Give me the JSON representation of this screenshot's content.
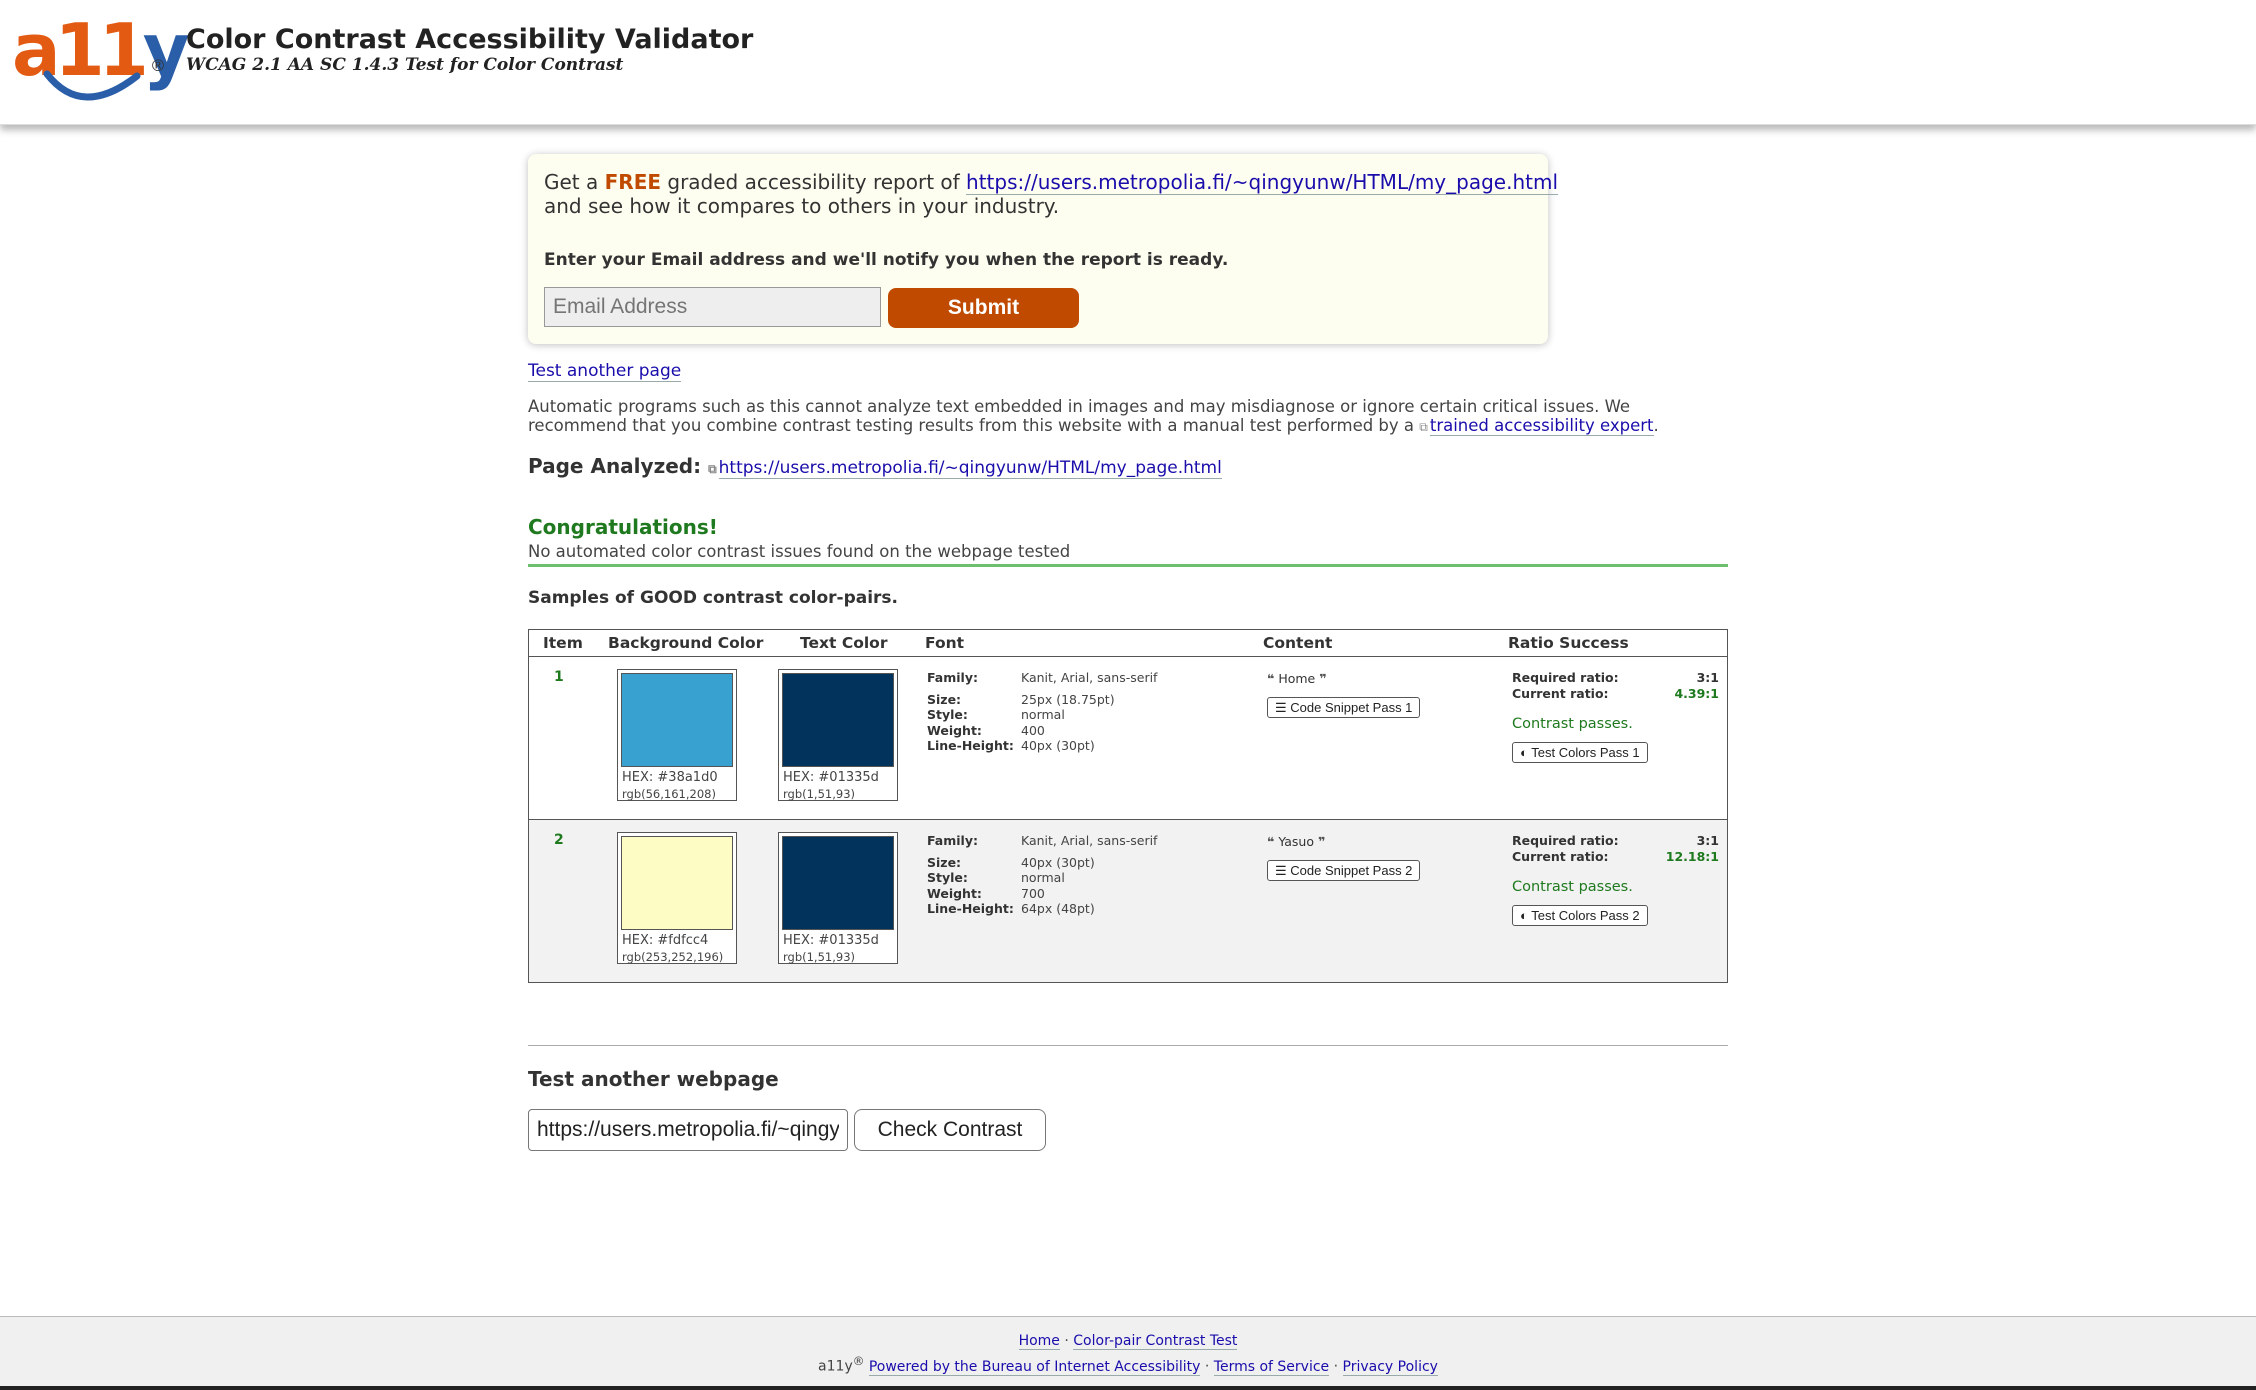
{
  "header": {
    "logo": {
      "text_a": "a",
      "text_11": "11",
      "text_y": "y",
      "reg": "®"
    },
    "title": "Color Contrast Accessibility Validator",
    "subtitle": "WCAG 2.1 AA SC 1.4.3 Test for Color Contrast"
  },
  "promo": {
    "line1_prefix": "Get a ",
    "free": "FREE",
    "line1_middle": " graded accessibility report of ",
    "url": "https://users.metropolia.fi/~qingyunw/HTML/my_page.html",
    "line2": "and see how it compares to others in your industry.",
    "notify": "Enter your Email address and we'll notify you when the report is ready.",
    "email_placeholder": "Email Address",
    "submit_label": "Submit"
  },
  "test_another_link": "Test another page",
  "disclaimer": {
    "text": "Automatic programs such as this cannot analyze text embedded in images and may misdiagnose or ignore certain critical issues. We recommend that you combine contrast testing results from this website with a manual test performed by a ",
    "link": "trained accessibility expert",
    "end": "."
  },
  "page_analyzed": {
    "label": "Page Analyzed:",
    "url": "https://users.metropolia.fi/~qingyunw/HTML/my_page.html"
  },
  "result": {
    "title": "Congratulations!",
    "message": "No automated color contrast issues found on the webpage tested"
  },
  "samples_heading": "Samples of GOOD contrast color-pairs.",
  "table": {
    "headers": [
      "Item",
      "Background Color",
      "Text Color",
      "Font",
      "Content",
      "Ratio Success"
    ],
    "font_keys": [
      "Family:",
      "Size:",
      "Style:",
      "Weight:",
      "Line-Height:"
    ],
    "ratio_keys": [
      "Required ratio:",
      "Current ratio:"
    ],
    "rows": [
      {
        "item": "1",
        "bg": {
          "color": "#38a1d0",
          "hex": "HEX: #38a1d0",
          "rgb": "rgb(56,161,208)"
        },
        "text": {
          "color": "#01335d",
          "hex": "HEX: #01335d",
          "rgb": "rgb(1,51,93)"
        },
        "font": {
          "family": "Kanit, Arial, sans-serif",
          "size": "25px (18.75pt)",
          "style": "normal",
          "weight": "400",
          "line_height": "40px (30pt)"
        },
        "content": {
          "open_quote": "❝",
          "text": "Home",
          "close_quote": "❞",
          "snippet_label": "Code Snippet Pass 1"
        },
        "ratio": {
          "required": "3:1",
          "current": "4.39:1",
          "passes": "Contrast passes.",
          "test_colors_label": "Test Colors Pass 1"
        }
      },
      {
        "item": "2",
        "bg": {
          "color": "#fdfcc4",
          "hex": "HEX: #fdfcc4",
          "rgb": "rgb(253,252,196)"
        },
        "text": {
          "color": "#01335d",
          "hex": "HEX: #01335d",
          "rgb": "rgb(1,51,93)"
        },
        "font": {
          "family": "Kanit, Arial, sans-serif",
          "size": "40px (30pt)",
          "style": "normal",
          "weight": "700",
          "line_height": "64px (48pt)"
        },
        "content": {
          "open_quote": "❝",
          "text": "Yasuo",
          "close_quote": "❞",
          "snippet_label": "Code Snippet Pass 2"
        },
        "ratio": {
          "required": "3:1",
          "current": "12.18:1",
          "passes": "Contrast passes.",
          "test_colors_label": "Test Colors Pass 2"
        }
      }
    ]
  },
  "test_webpage": {
    "heading": "Test another webpage",
    "url_value": "https://users.metropolia.fi/~qingyunw/HTML/my_page.html",
    "check_label": "Check Contrast"
  },
  "footer": {
    "home": "Home",
    "sep": " · ",
    "pair_test": "Color-pair Contrast Test",
    "brand": "a11y",
    "reg": "®",
    "powered": "Powered by the Bureau of Internet Accessibility",
    "terms": "Terms of Service",
    "privacy": "Privacy Policy"
  },
  "colors": {
    "accent": "#c04a00",
    "success": "#1f7a1f",
    "link": "#1a0dab",
    "logo_blue": "#2a5ea8",
    "logo_orange": "#e35b13"
  },
  "icons": [
    "external-link-icon",
    "code-icon",
    "contrast-icon",
    "quote-open-icon",
    "quote-close-icon"
  ]
}
